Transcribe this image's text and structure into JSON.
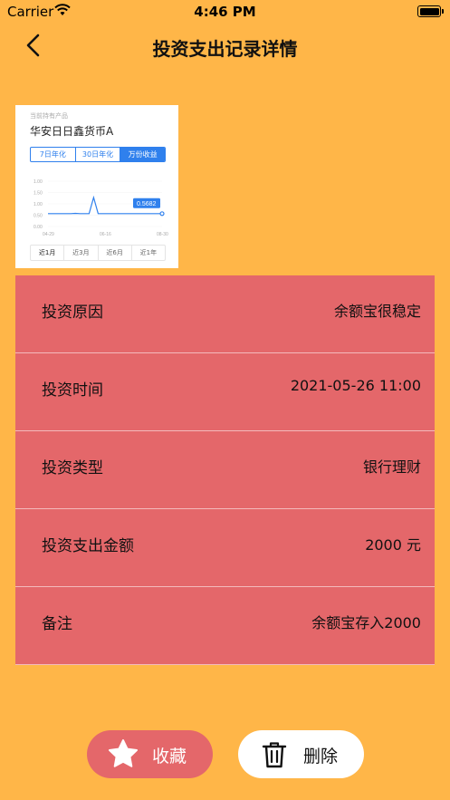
{
  "status_bar": {
    "carrier": "Carrier",
    "time": "4:46 PM",
    "icons": [
      "wifi-icon",
      "battery-icon"
    ]
  },
  "nav": {
    "title": "投资支出记录详情",
    "back_icon": "chevron-left-icon"
  },
  "product_card": {
    "subtitle": "当前持有产品",
    "title": "华安日日鑫货币A",
    "segments": [
      "7日年化",
      "30日年化",
      "万份收益"
    ],
    "active_segment": "万份收益",
    "chart_tabs": [
      "近1月",
      "近3月",
      "近6月",
      "近1年"
    ],
    "active_tab": "近1月",
    "chart_data": {
      "type": "line",
      "x_ticks": [
        "04-29",
        "06-16",
        "08-30"
      ],
      "y_ticks": [
        "1.00",
        "1.50",
        "1.00",
        "0.50",
        "0.00"
      ],
      "series": [
        {
          "values": [
            0.57,
            0.57,
            0.57,
            0.57,
            0.57,
            0.57,
            0.58,
            0.57,
            0.57,
            0.57,
            1.28,
            0.57,
            0.57,
            0.57,
            0.57,
            0.57,
            0.57,
            0.57,
            0.57,
            0.57,
            0.57,
            0.57,
            0.57,
            0.57,
            0.57,
            0.5682
          ]
        }
      ],
      "highlight_label": "0.5682",
      "line_color": "#2f80ed"
    }
  },
  "details": [
    {
      "label": "投资原因",
      "value": "余额宝很稳定"
    },
    {
      "label": "投资时间",
      "value": "2021-05-26 11:00"
    },
    {
      "label": "投资类型",
      "value": "银行理财"
    },
    {
      "label": "投资支出金额",
      "value": "2000 元"
    },
    {
      "label": "备注",
      "value": "余额宝存入2000"
    }
  ],
  "actions": {
    "favorite_label": "收藏",
    "favorite_icon": "star-icon",
    "delete_label": "删除",
    "delete_icon": "trash-icon"
  },
  "colors": {
    "background": "#FFB648",
    "panel": "#E4676A",
    "accent": "#2f80ed"
  }
}
